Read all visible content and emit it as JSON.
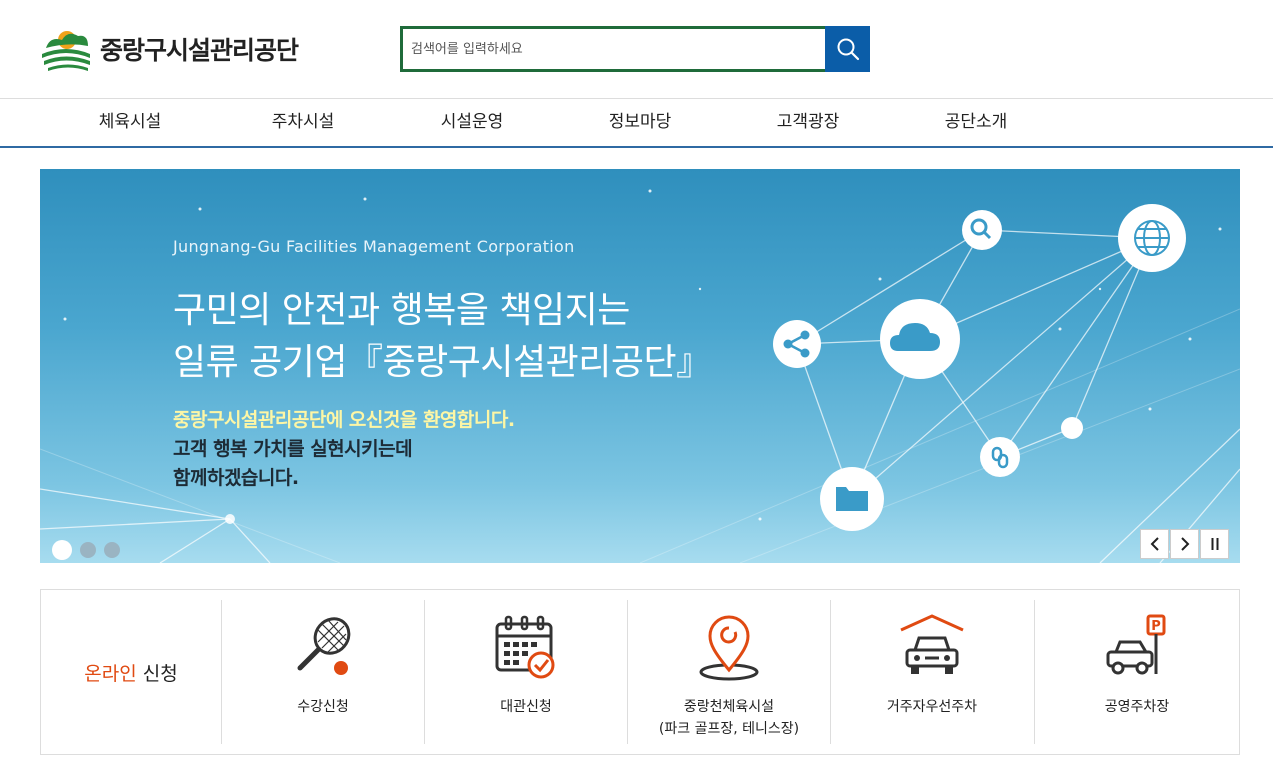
{
  "header": {
    "logo_text": "중랑구시설관리공단",
    "search_placeholder": "검색어를 입력하세요"
  },
  "nav": {
    "items": [
      "체육시설",
      "주차시설",
      "시설운영",
      "정보마당",
      "고객광장",
      "공단소개"
    ]
  },
  "banner": {
    "subtitle": "Jungnang-Gu Facilities Management Corporation",
    "title_line1": "구민의 안전과 행복을 책임지는",
    "title_line2": "일류 공기업『중랑구시설관리공단』",
    "highlight": "중랑구시설관리공단에 오신것을 환영합니다.",
    "line2": "고객 행복 가치를 실현시키는데",
    "line3": "함께하겠습니다.",
    "slide_count": 3,
    "active_slide": 1
  },
  "quick_menu": {
    "label_highlight": "온라인",
    "label_rest": "신청",
    "items": [
      {
        "label": "수강신청",
        "icon": "tennis-racket-icon"
      },
      {
        "label": "대관신청",
        "icon": "calendar-check-icon"
      },
      {
        "label": "중랑천체육시설",
        "label2": "(파크 골프장, 테니스장)",
        "icon": "location-pin-icon"
      },
      {
        "label": "거주자우선주차",
        "icon": "garage-car-icon"
      },
      {
        "label": "공영주차장",
        "icon": "parking-car-icon"
      }
    ]
  },
  "colors": {
    "accent_green": "#1f6b3a",
    "search_blue": "#0b5da8",
    "nav_border": "#2f6aa3",
    "orange": "#e04a12"
  }
}
